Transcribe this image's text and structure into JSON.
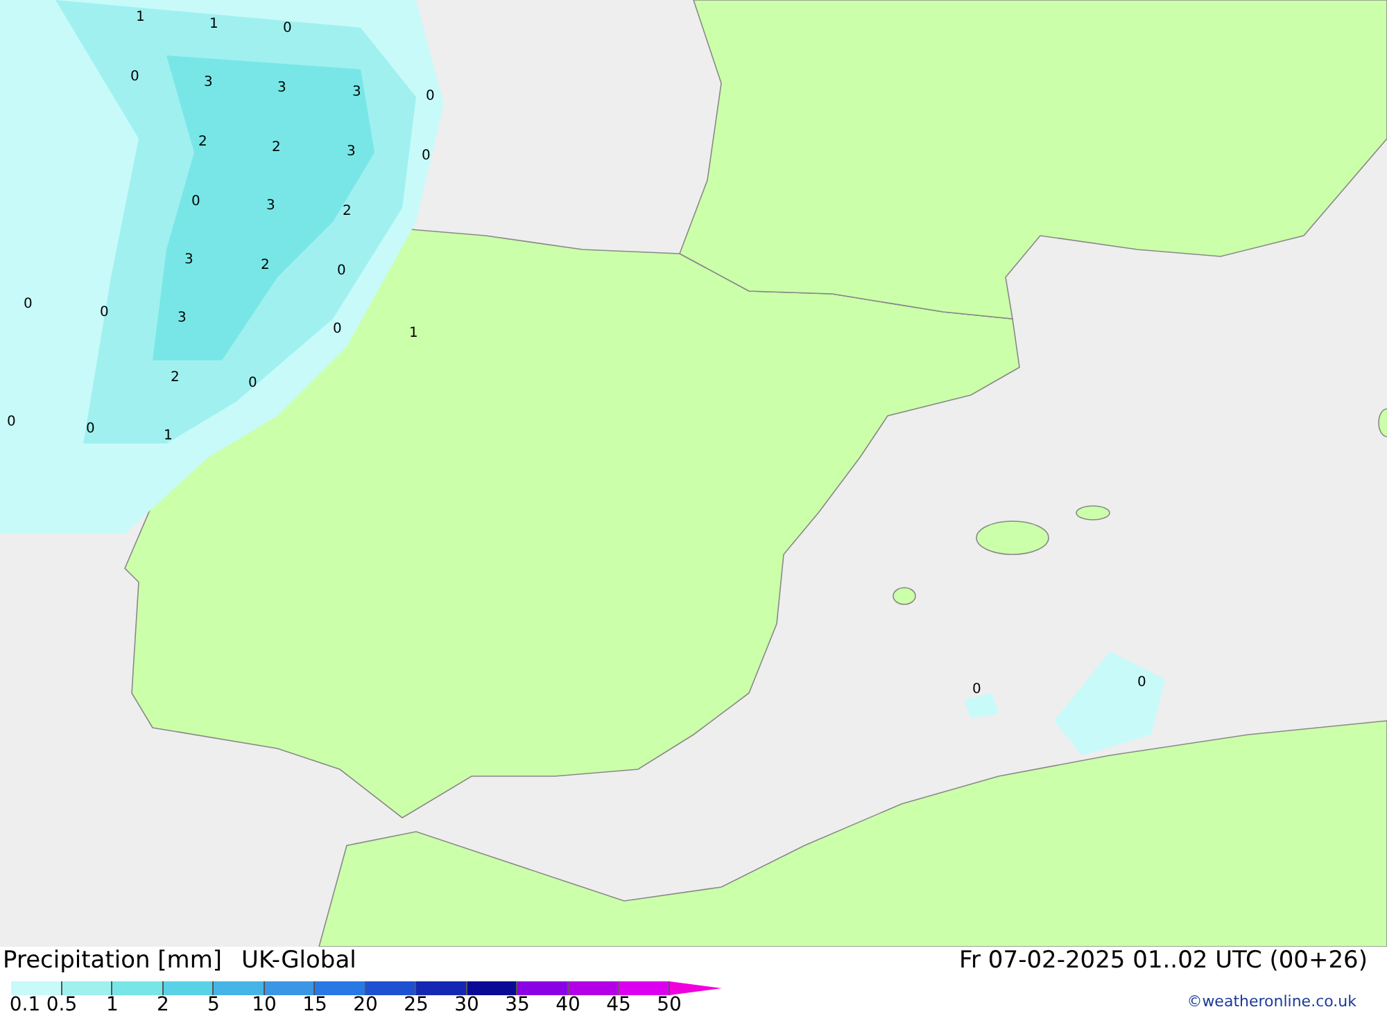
{
  "map": {
    "contour_labels": [
      "1",
      "1",
      "0",
      "0",
      "3",
      "3",
      "3",
      "0",
      "2",
      "2",
      "3",
      "0",
      "0",
      "3",
      "2",
      "3",
      "2",
      "0",
      "0",
      "0",
      "3",
      "0",
      "1",
      "2",
      "0",
      "0",
      "0",
      "1",
      "0",
      "0"
    ]
  },
  "legend": {
    "title": "Precipitation [mm]",
    "model": "UK-Global",
    "valid_time": "Fr 07-02-2025 01..02 UTC (00+26)",
    "scale": [
      {
        "label": "0.1",
        "color": "#c8fafa"
      },
      {
        "label": "0.5",
        "color": "#a0f0f0"
      },
      {
        "label": "1",
        "color": "#78e6e6"
      },
      {
        "label": "2",
        "color": "#5ad2e6"
      },
      {
        "label": "5",
        "color": "#46b4e6"
      },
      {
        "label": "10",
        "color": "#3c96e6"
      },
      {
        "label": "15",
        "color": "#2878e6"
      },
      {
        "label": "20",
        "color": "#1e50d2"
      },
      {
        "label": "25",
        "color": "#1428b4"
      },
      {
        "label": "30",
        "color": "#0a0a96"
      },
      {
        "label": "35",
        "color": "#8c00e6"
      },
      {
        "label": "40",
        "color": "#b400e6"
      },
      {
        "label": "45",
        "color": "#dc00f0"
      },
      {
        "label": "50",
        "color": "#f000dc"
      }
    ],
    "credit": "©weatheronline.co.uk"
  }
}
